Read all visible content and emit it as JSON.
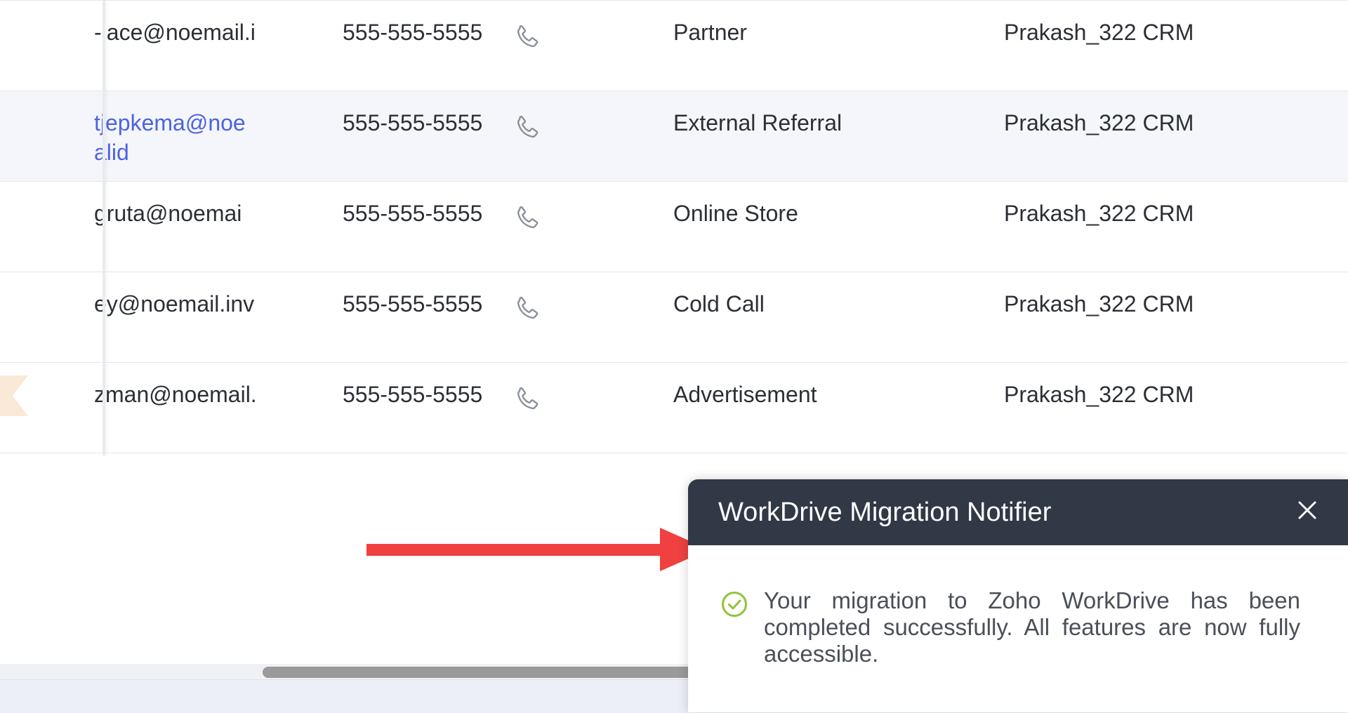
{
  "table": {
    "rows": [
      {
        "email": "-lace@noemail.i",
        "email_is_link": false,
        "phone": "555-555-5555",
        "lead_source": "Partner",
        "owner": "Prakash_322 CRM"
      },
      {
        "email": "tjepkema@noe\nalid",
        "email_is_link": true,
        "phone": "555-555-5555",
        "lead_source": "External Referral",
        "owner": "Prakash_322 CRM"
      },
      {
        "email": "gruta@noemai",
        "email_is_link": false,
        "phone": "555-555-5555",
        "lead_source": "Online Store",
        "owner": "Prakash_322 CRM"
      },
      {
        "email": "ey@noemail.inv",
        "email_is_link": false,
        "phone": "555-555-5555",
        "lead_source": "Cold Call",
        "owner": "Prakash_322 CRM"
      },
      {
        "email": "zman@noemail.",
        "email_is_link": false,
        "phone": "555-555-5555",
        "lead_source": "Advertisement",
        "owner": "Prakash_322 CRM"
      }
    ],
    "phone_icon": "phone-icon"
  },
  "notifier": {
    "title": "WorkDrive Migration Notifier",
    "message": "Your migration to Zoho WorkDrive has been completed successfully. All features are now fully accessible.",
    "status_icon": "check-circle-icon",
    "close_icon": "close-icon"
  },
  "scrollbar": {
    "horizontal_position": 0.32
  },
  "colors": {
    "link": "#4d63df",
    "header_bg": "#313846",
    "success": "#8fc33a",
    "annotation_arrow": "#f04040",
    "alt_row_bg": "#f4f6fb",
    "flag": "#fbe9d8"
  }
}
